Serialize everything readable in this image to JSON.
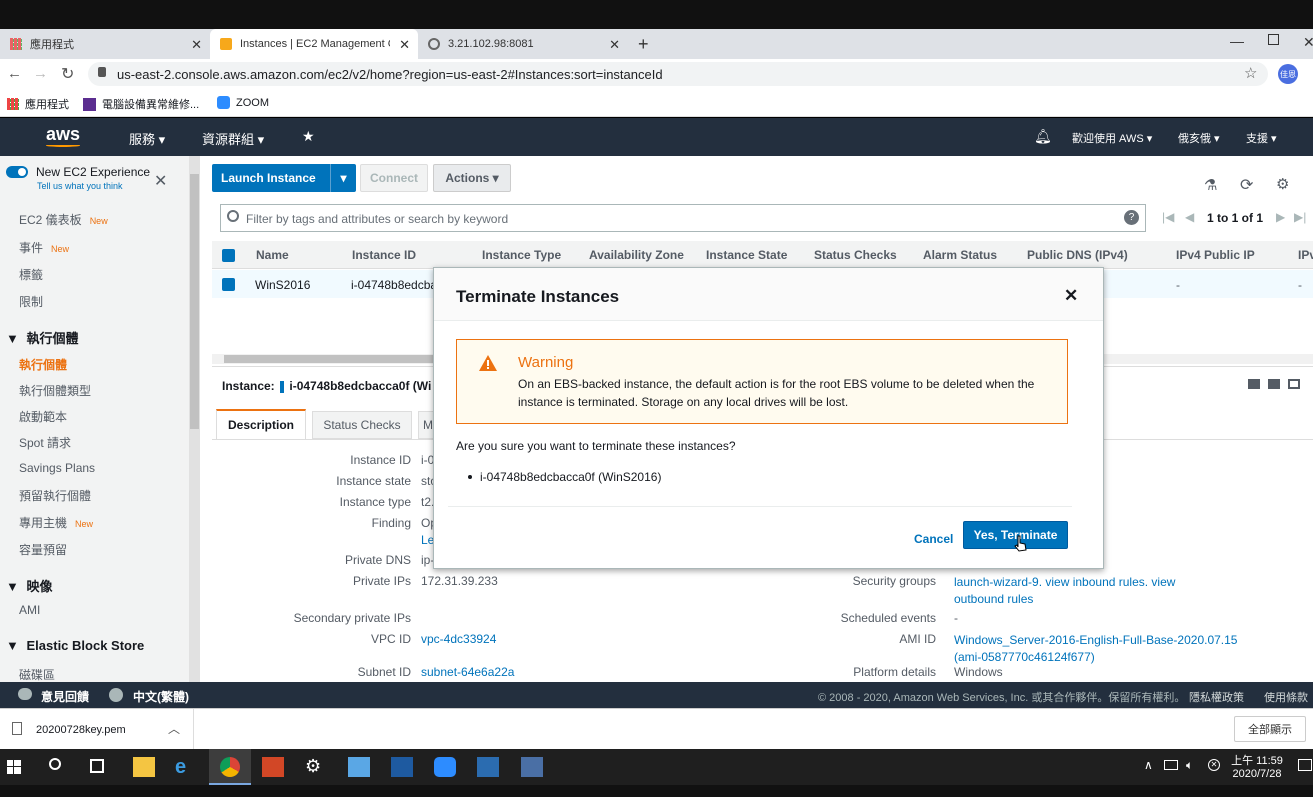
{
  "browser": {
    "tabs": [
      {
        "label": "應用程式"
      },
      {
        "label": "Instances | EC2 Management C"
      },
      {
        "label": "3.21.102.98:8081"
      }
    ],
    "url": "us-east-2.console.aws.amazon.com/ec2/v2/home?region=us-east-2#Instances:sort=instanceId",
    "profile": "佳恩",
    "bookmarks": [
      {
        "label": "應用程式"
      },
      {
        "label": "電腦設備異常維修..."
      },
      {
        "label": "ZOOM"
      }
    ]
  },
  "aws_nav": {
    "logo": "aws",
    "services": "服務",
    "resource_groups": "資源群組",
    "welcome": "歡迎使用 AWS",
    "region": "俄亥俄",
    "support": "支援"
  },
  "sidebar": {
    "toggle_title": "New EC2 Experience",
    "toggle_sub": "Tell us what you think",
    "new_badge": "New",
    "items": [
      {
        "label": "EC2 儀表板",
        "new": true
      },
      {
        "label": "事件",
        "new": true
      },
      {
        "label": "標籤"
      },
      {
        "label": "限制"
      }
    ],
    "section_instances": "執行個體",
    "instance_items": [
      {
        "label": "執行個體"
      },
      {
        "label": "執行個體類型"
      },
      {
        "label": "啟動範本"
      },
      {
        "label": "Spot 請求"
      },
      {
        "label": "Savings Plans"
      },
      {
        "label": "預留執行個體"
      },
      {
        "label": "專用主機",
        "new": true
      },
      {
        "label": "容量預留"
      }
    ],
    "section_images": "映像",
    "image_items": [
      {
        "label": "AMI"
      }
    ],
    "section_ebs": "Elastic Block Store",
    "ebs_items": [
      {
        "label": "磁碟區"
      }
    ]
  },
  "toolbar": {
    "launch": "Launch Instance",
    "connect": "Connect",
    "actions": "Actions",
    "search_placeholder": "Filter by tags and attributes or search by keyword",
    "pagination": "1 to 1 of 1"
  },
  "table": {
    "headers": [
      "Name",
      "Instance ID",
      "Instance Type",
      "Availability Zone",
      "Instance State",
      "Status Checks",
      "Alarm Status",
      "Public DNS (IPv4)",
      "IPv4 Public IP",
      "IPv"
    ],
    "row": {
      "name": "WinS2016",
      "instance_id": "i-04748b8edcba",
      "dns": "-",
      "ip": "-"
    }
  },
  "detail": {
    "instance_label": "Instance:",
    "instance_value": "i-04748b8edcbacca0f (Wi",
    "tabs": [
      "Description",
      "Status Checks",
      "M"
    ],
    "fields_left": [
      {
        "label": "Instance ID",
        "value": "i-0"
      },
      {
        "label": "Instance state",
        "value": "sto"
      },
      {
        "label": "Instance type",
        "value": "t2."
      },
      {
        "label": "Finding",
        "value": "Op"
      },
      {
        "label": "",
        "value": "Le"
      },
      {
        "label": "Private DNS",
        "value": "ip-"
      },
      {
        "label": "Private IPs",
        "value": "172.31.39.233"
      },
      {
        "label": "Secondary private IPs",
        "value": ""
      },
      {
        "label": "VPC ID",
        "value": "vpc-4dc33924"
      },
      {
        "label": "Subnet ID",
        "value": "subnet-64e6a22a"
      }
    ],
    "security_groups_label": "Security groups",
    "security_groups_value": "launch-wizard-9. view inbound rules. view outbound rules",
    "scheduled_events_label": "Scheduled events",
    "scheduled_events_value": "-",
    "ami_id_label": "AMI ID",
    "ami_id_value": "Windows_Server-2016-English-Full-Base-2020.07.15 (ami-0587770c46124f677)",
    "platform_label": "Platform details",
    "platform_value": "Windows"
  },
  "modal": {
    "title": "Terminate Instances",
    "warning_title": "Warning",
    "warning_text": "On an EBS-backed instance, the default action is for the root EBS volume to be deleted when the instance is terminated. Storage on any local drives will be lost.",
    "question": "Are you sure you want to terminate these instances?",
    "instance_item": "i-04748b8edcbacca0f (WinS2016)",
    "cancel": "Cancel",
    "confirm": "Yes, Terminate"
  },
  "footer": {
    "feedback": "意見回饋",
    "language": "中文(繁體)",
    "copyright": "© 2008 - 2020, Amazon Web Services, Inc. 或其合作夥伴。保留所有權利。",
    "privacy": "隱私權政策",
    "terms": "使用條款"
  },
  "download": {
    "file": "20200728key.pem",
    "show_all": "全部顯示"
  },
  "taskbar": {
    "time": "上午 11:59",
    "date": "2020/7/28"
  },
  "colors": {
    "aws_nav": "#232f3e",
    "primary_button": "#0073bb",
    "warning_orange": "#ec7211",
    "warning_bg": "#fffbef"
  }
}
